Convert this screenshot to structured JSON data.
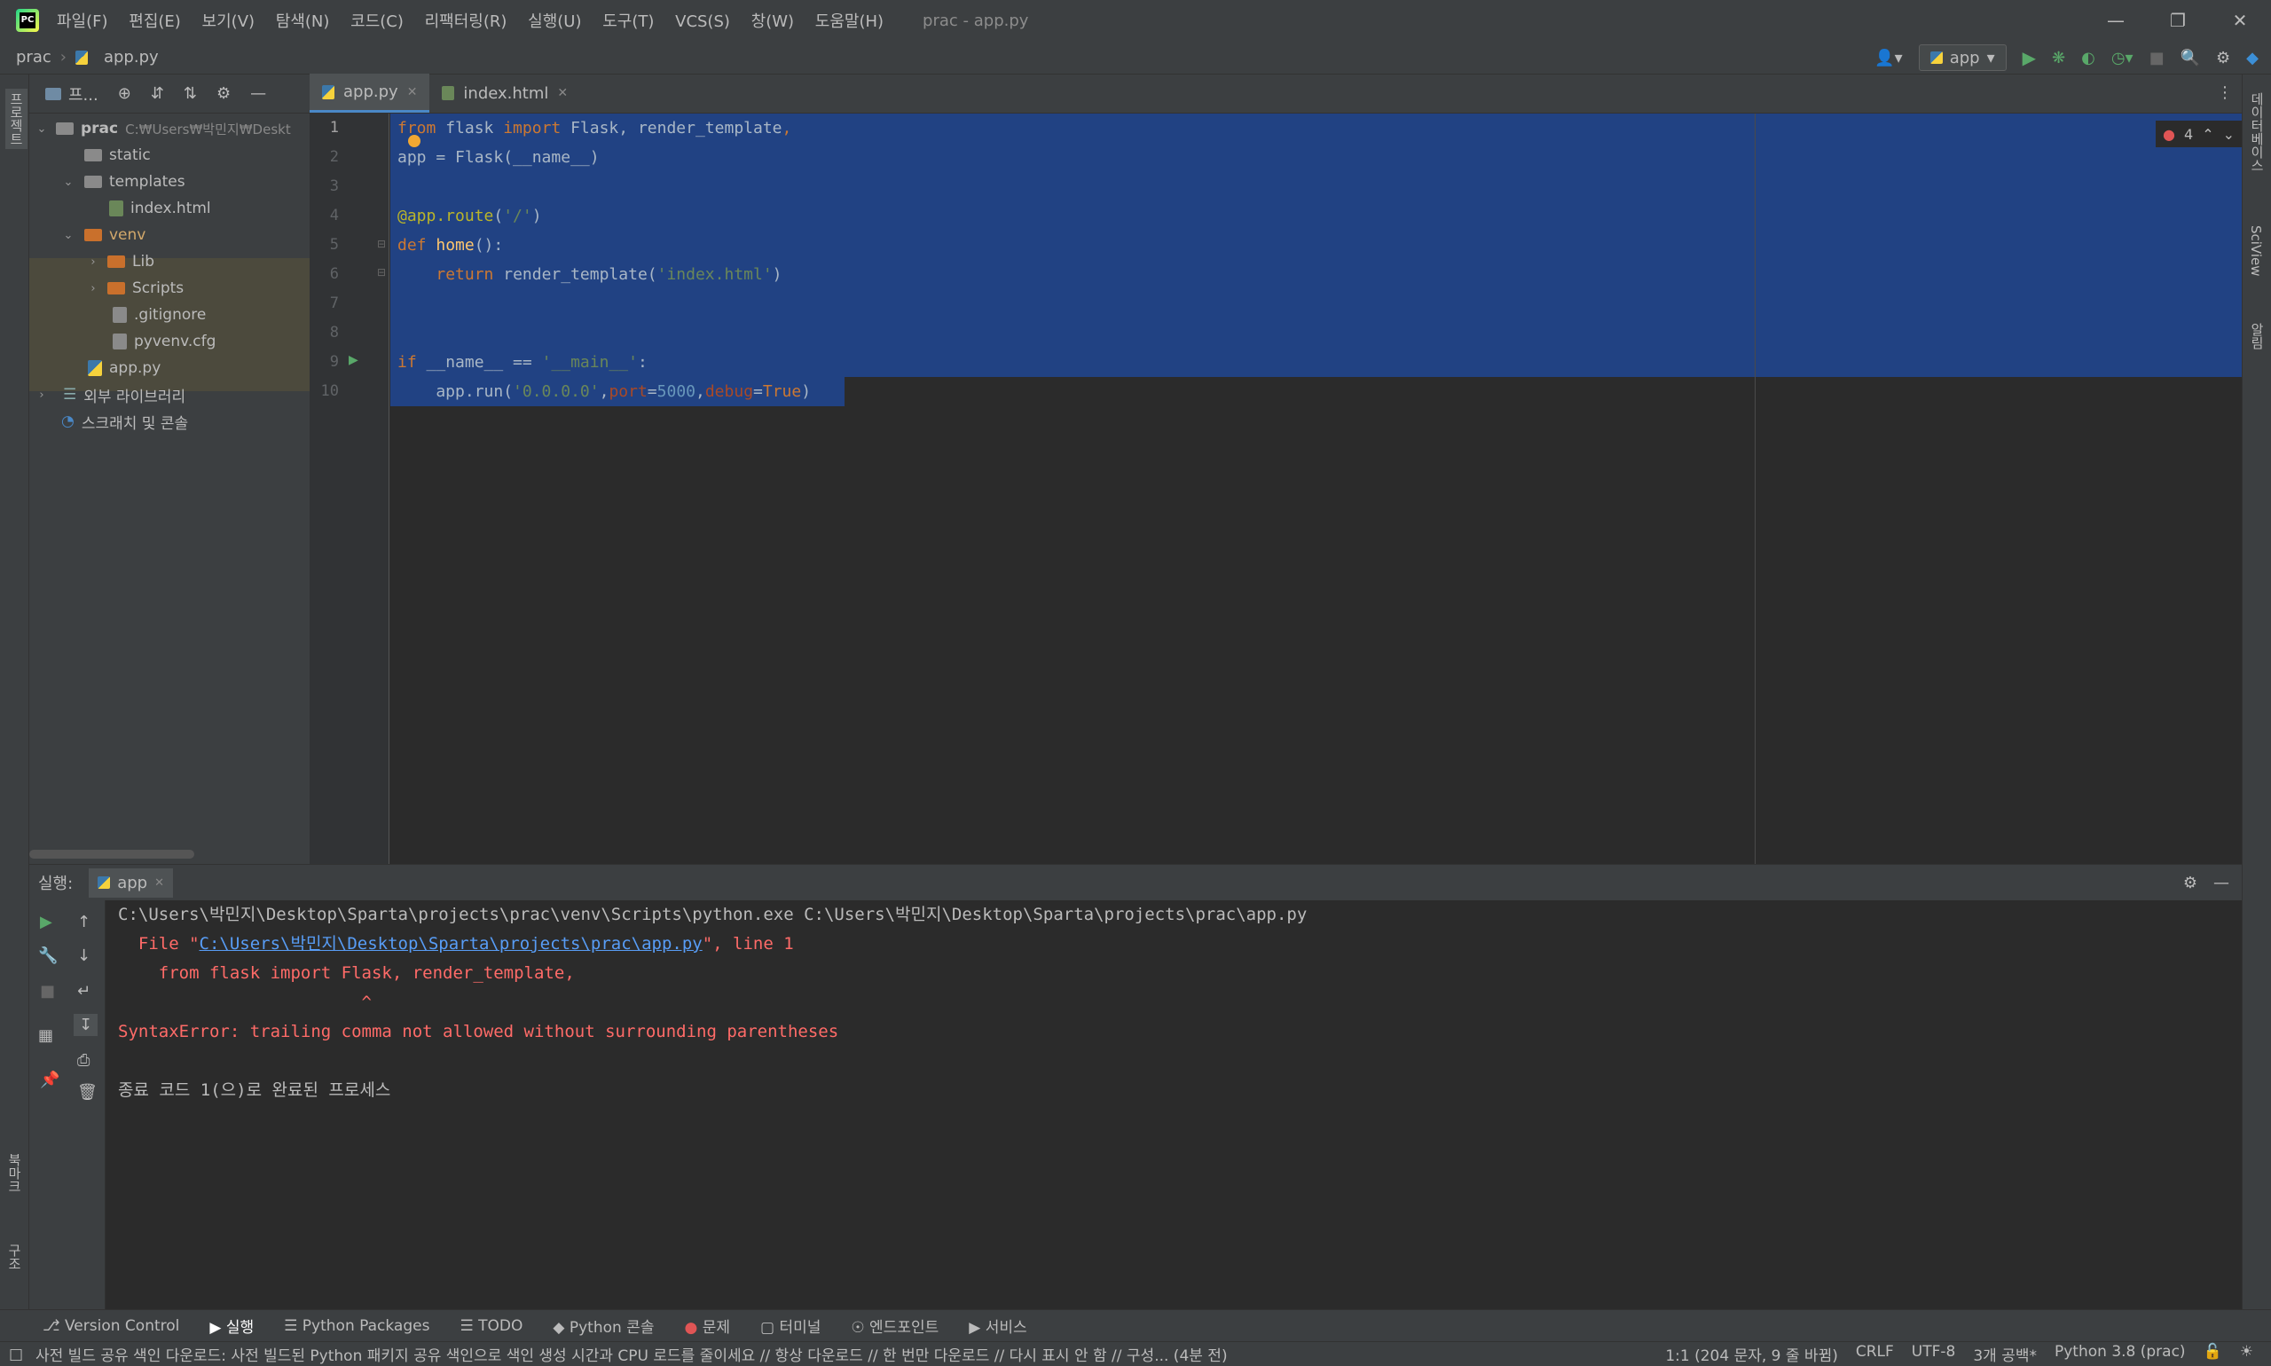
{
  "menu": [
    "파일(F)",
    "편집(E)",
    "보기(V)",
    "탐색(N)",
    "코드(C)",
    "리팩터링(R)",
    "실행(U)",
    "도구(T)",
    "VCS(S)",
    "창(W)",
    "도움말(H)"
  ],
  "window_title": "prac - app.py",
  "breadcrumb": {
    "project": "prac",
    "file": "app.py"
  },
  "run_config": "app",
  "project_tab": "프...",
  "tree": {
    "root": "prac",
    "root_path": "C:₩Users₩박민지₩Deskt",
    "static": "static",
    "templates": "templates",
    "index": "index.html",
    "venv": "venv",
    "lib": "Lib",
    "scripts": "Scripts",
    "gitignore": ".gitignore",
    "pyvenv": "pyvenv.cfg",
    "app": "app.py",
    "external": "외부 라이브러리",
    "scratch": "스크래치 및 콘솔"
  },
  "tabs": [
    "app.py",
    "index.html"
  ],
  "error_count": "4",
  "left_strip": {
    "project": "프로젝트",
    "bookmarks": "북마크",
    "structure": "구조"
  },
  "right_strip": {
    "database": "데이터베이스",
    "sciview": "SciView",
    "notifications": "알림"
  },
  "code_lines": [
    {
      "n": "1",
      "text": "from flask import Flask, render_template,"
    },
    {
      "n": "2",
      "text": "app = Flask(__name__)"
    },
    {
      "n": "3",
      "text": ""
    },
    {
      "n": "4",
      "text": "@app.route('/')"
    },
    {
      "n": "5",
      "text": "def home():"
    },
    {
      "n": "6",
      "text": "    return render_template('index.html')"
    },
    {
      "n": "7",
      "text": ""
    },
    {
      "n": "8",
      "text": ""
    },
    {
      "n": "9",
      "text": "if __name__ == '__main__':"
    },
    {
      "n": "10",
      "text": "    app.run('0.0.0.0',port=5000,debug=True)"
    }
  ],
  "run": {
    "label": "실행:",
    "tab": "app",
    "cmd": "C:\\Users\\박민지\\Desktop\\Sparta\\projects\\prac\\venv\\Scripts\\python.exe C:\\Users\\박민지\\Desktop\\Sparta\\projects\\prac\\app.py",
    "file_prefix": "  File \"",
    "file_link": "C:\\Users\\박민지\\Desktop\\Sparta\\projects\\prac\\app.py",
    "file_suffix": "\", line 1",
    "src_line": "    from flask import Flask, render_template,",
    "caret": "                        ^",
    "error": "SyntaxError: trailing comma not allowed without surrounding parentheses",
    "exit": "종료 코드 1(으)로 완료된 프로세스"
  },
  "bottom_tabs": [
    "Version Control",
    "실행",
    "Python Packages",
    "TODO",
    "Python 콘솔",
    "문제",
    "터미널",
    "엔드포인트",
    "서비스"
  ],
  "status": {
    "message": "사전 빌드 공유 색인 다운로드: 사전 빌드된 Python 패키지 공유 색인으로 색인 생성 시간과 CPU 로드를 줄이세요 // 항상 다운로드 // 한 번만 다운로드 // 다시 표시 안 함 // 구성... (4분 전)",
    "position": "1:1 (204 문자, 9 줄 바뀜)",
    "line_sep": "CRLF",
    "encoding": "UTF-8",
    "indent": "3개 공백*",
    "interpreter": "Python 3.8 (prac)"
  },
  "colors": {
    "selection": "#214283",
    "bg": "#2b2b2b",
    "panel": "#3c3f41",
    "error": "#ff6b68",
    "link": "#589df6"
  }
}
